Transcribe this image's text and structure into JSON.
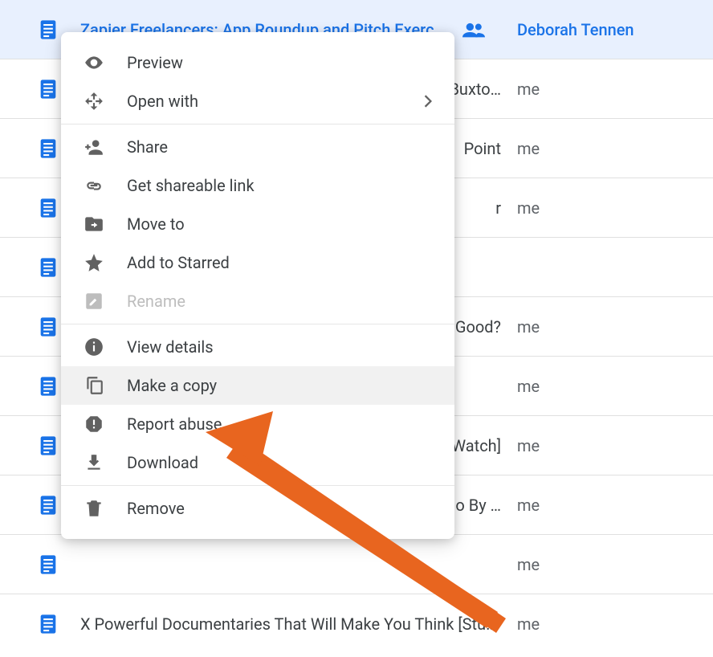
{
  "files": [
    {
      "title": "Zapier Freelancers: App Roundup and Pitch Exercises",
      "owner": "Deborah Tennen",
      "shared": true,
      "selected": true
    },
    {
      "title": "n Buxto…",
      "owner": "me",
      "shared": false,
      "selected": false
    },
    {
      "title": "Point",
      "owner": "me",
      "shared": false,
      "selected": false
    },
    {
      "title": "r",
      "owner": "me",
      "shared": false,
      "selected": false
    },
    {
      "title": "",
      "owner": "",
      "shared": false,
      "selected": false
    },
    {
      "title": "ny Good?",
      "owner": "me",
      "shared": false,
      "selected": false
    },
    {
      "title": "",
      "owner": "me",
      "shared": false,
      "selected": false
    },
    {
      "title": "Watch]",
      "owner": "me",
      "shared": false,
      "selected": false
    },
    {
      "title": "d Go By …",
      "owner": "me",
      "shared": false,
      "selected": false
    },
    {
      "title": "",
      "owner": "me",
      "shared": false,
      "selected": false
    },
    {
      "title": "X Powerful Documentaries That Will Make You Think [Stuf…",
      "owner": "me",
      "shared": false,
      "selected": false
    }
  ],
  "menu": {
    "preview": "Preview",
    "open_with": "Open with",
    "share": "Share",
    "get_link": "Get shareable link",
    "move_to": "Move to",
    "add_star": "Add to Starred",
    "rename": "Rename",
    "view_details": "View details",
    "make_copy": "Make a copy",
    "report_abuse": "Report abuse",
    "download": "Download",
    "remove": "Remove"
  },
  "highlighted_action": "make_copy",
  "colors": {
    "accent": "#1a73e8",
    "arrow": "#e8651f"
  }
}
